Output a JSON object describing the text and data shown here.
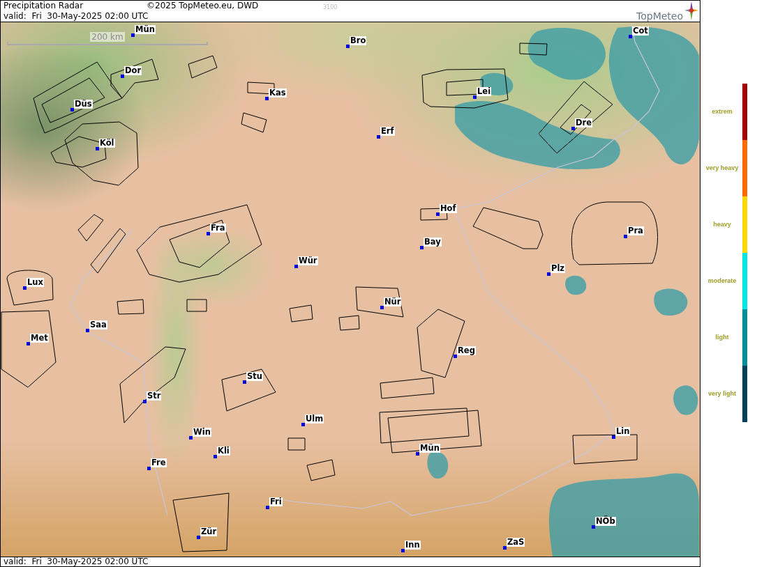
{
  "header": {
    "title": "Precipitation Radar",
    "copyright": "©2025 TopMeteo.eu, DWD",
    "number": "3100",
    "valid": "valid:  Fri  30-May-2025 02:00 UTC",
    "logo": "TopMeteo"
  },
  "map": {
    "scale_label": "200 km",
    "cities": [
      "Mün",
      "Cot",
      "Bro",
      "Dor",
      "Lei",
      "Kas",
      "Düs",
      "Dre",
      "Erf",
      "Köl",
      "Hof",
      "Fra",
      "Pra",
      "Bay",
      "Wür",
      "Plz",
      "Lux",
      "Nür",
      "Saa",
      "Met",
      "Reg",
      "Stu",
      "Str",
      "Ulm",
      "Lin",
      "Win",
      "Mün",
      "Kli",
      "Fre",
      "Fri",
      "NÖb",
      "Zür",
      "ZaS",
      "Inn"
    ]
  },
  "footer": {
    "valid": "valid:  Fri  30-May-2025 02:00 UTC"
  },
  "legend": {
    "levels": [
      {
        "label": "extrem",
        "color": "#a50000"
      },
      {
        "label": "very heavy",
        "color": "#ff6a00"
      },
      {
        "label": "heavy",
        "color": "#ffd800"
      },
      {
        "label": "moderate",
        "color": "#00e5e5"
      },
      {
        "label": "light",
        "color": "#008e9a"
      },
      {
        "label": "very light",
        "color": "#00405a"
      }
    ]
  }
}
